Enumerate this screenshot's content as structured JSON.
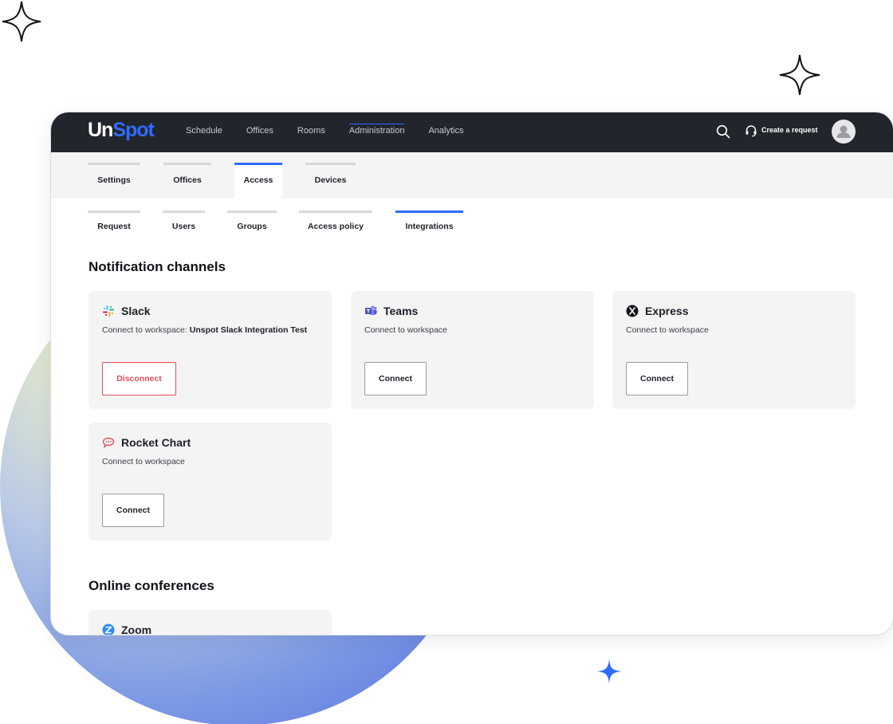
{
  "brand": {
    "part1": "Un",
    "part2": "Spot",
    "accent": "#2f6bff"
  },
  "topbar": {
    "nav": [
      {
        "label": "Schedule",
        "active": false
      },
      {
        "label": "Offices",
        "active": false
      },
      {
        "label": "Rooms",
        "active": false
      },
      {
        "label": "Administration",
        "active": true
      },
      {
        "label": "Analytics",
        "active": false
      }
    ],
    "search_icon": "search-icon",
    "support_icon": "headset-icon",
    "create_request": "Create a request",
    "avatar_icon": "user-avatar-icon"
  },
  "tabs_primary": [
    {
      "label": "Settings",
      "active": false
    },
    {
      "label": "Offices",
      "active": false
    },
    {
      "label": "Access",
      "active": true
    },
    {
      "label": "Devices",
      "active": false
    }
  ],
  "tabs_secondary": [
    {
      "label": "Request",
      "active": false
    },
    {
      "label": "Users",
      "active": false
    },
    {
      "label": "Groups",
      "active": false
    },
    {
      "label": "Access policy",
      "active": false
    },
    {
      "label": "Integrations",
      "active": true
    }
  ],
  "notification": {
    "title": "Notification channels",
    "cards": [
      {
        "name": "Slack",
        "icon": "slack-icon",
        "desc": "Connect to workspace: ",
        "desc_bold": "Unspot Slack Integration Test",
        "button": "Disconnect",
        "danger": true
      },
      {
        "name": "Teams",
        "icon": "teams-icon",
        "desc": "Connect to workspace",
        "desc_bold": "",
        "button": "Connect",
        "danger": false
      },
      {
        "name": "Express",
        "icon": "express-icon",
        "desc": "Connect to workspace",
        "desc_bold": "",
        "button": "Connect",
        "danger": false
      },
      {
        "name": "Rocket Chart",
        "icon": "rocket-chat-icon",
        "desc": "Connect to workspace",
        "desc_bold": "",
        "button": "Connect",
        "danger": false
      }
    ]
  },
  "conferences": {
    "title": "Online conferences",
    "cards": [
      {
        "name": "Zoom",
        "icon": "zoom-icon"
      }
    ]
  },
  "colors": {
    "danger": "#e3505a",
    "topbar": "#22252b"
  }
}
